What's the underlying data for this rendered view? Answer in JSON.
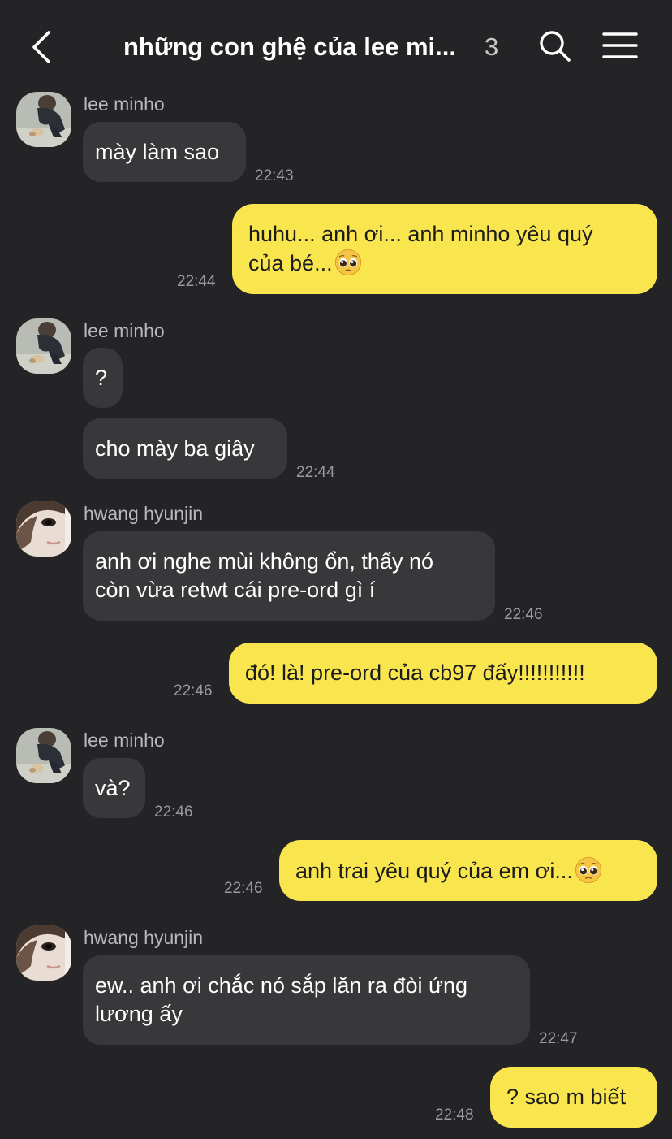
{
  "header": {
    "title": "những con ghệ của lee mi...",
    "member_count": "3"
  },
  "emoji": {
    "pleading": "pleading-face"
  },
  "colors": {
    "background": "#242426",
    "incoming_bubble": "#38383b",
    "outgoing_bubble": "#f9e54e"
  },
  "messages": [
    {
      "sender": "lee minho",
      "text": "mày làm sao",
      "time": "22:43"
    },
    {
      "text": "huhu... anh ơi... anh minho yêu quý\ncủa bé...",
      "time": "22:44"
    },
    {
      "sender": "lee minho",
      "text": "?"
    },
    {
      "text": "cho mày ba giây",
      "time": "22:44"
    },
    {
      "sender": "hwang hyunjin",
      "text": "anh ơi nghe mùi không ổn, thấy nó\ncòn vừa retwt cái pre-ord gì í",
      "time": "22:46"
    },
    {
      "text": "đó! là! pre-ord của cb97 đấy!!!!!!!!!!!",
      "time": "22:46"
    },
    {
      "sender": "lee minho",
      "text": "và?",
      "time": "22:46"
    },
    {
      "text": "anh trai yêu quý của em ơi...",
      "time": "22:46"
    },
    {
      "sender": "hwang hyunjin",
      "text": "ew.. anh ơi chắc nó sắp lăn ra đòi ứng\nlương ấy",
      "time": "22:47"
    },
    {
      "text": "? sao m biết",
      "time": "22:48"
    }
  ]
}
